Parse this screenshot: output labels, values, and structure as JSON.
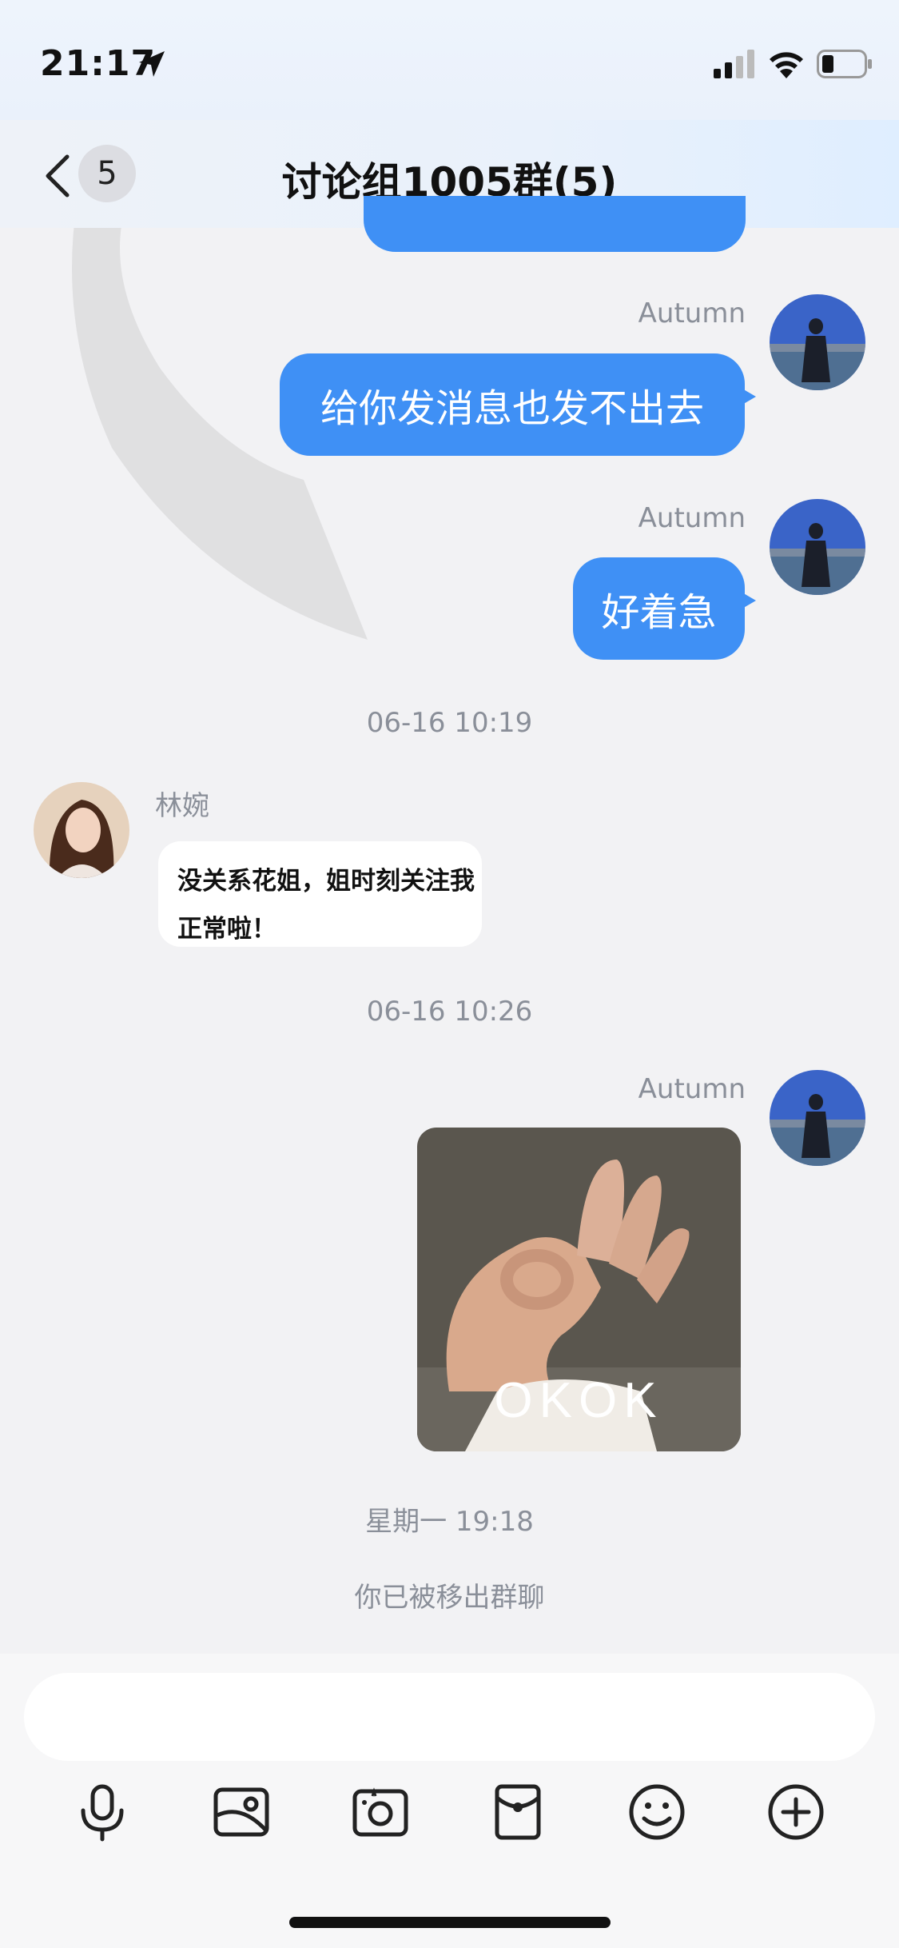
{
  "status_bar": {
    "time": "21:17"
  },
  "header": {
    "back_count": "5",
    "title": "讨论组1005群(5)"
  },
  "messages": [
    {
      "sender": "Autumn",
      "text": "给你发消息也发不出去"
    },
    {
      "sender": "Autumn",
      "text": "好着急"
    },
    {
      "timestamp": "06-16 10:19"
    },
    {
      "sender": "林婉",
      "text_line1": "没关系花姐，姐时刻关注我",
      "text_line2": "正常啦！"
    },
    {
      "timestamp": "06-16 10:26"
    },
    {
      "sender": "Autumn",
      "sticker_caption": "OKOK"
    },
    {
      "timestamp": "星期一 19:18"
    }
  ],
  "system_note": "你已被移出群聊",
  "toolbar": {
    "icons": [
      "microphone-icon",
      "photo-album-icon",
      "camera-icon",
      "red-packet-icon",
      "emoji-icon",
      "plus-icon"
    ]
  },
  "colors": {
    "bubble_blue": "#3f90f5",
    "background": "#f2f2f4",
    "meta_text": "#8a8f99"
  }
}
